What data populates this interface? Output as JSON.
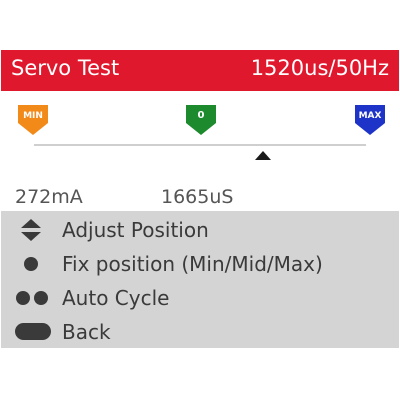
{
  "header": {
    "title": "Servo Test",
    "status": "1520us/50Hz",
    "background": "#e0182d"
  },
  "markers": {
    "min": {
      "label": "MIN",
      "color": "#f28a1a",
      "icon": "min-flag-icon"
    },
    "mid": {
      "label": "0",
      "color": "#1d8a2e",
      "icon": "zero-flag-icon"
    },
    "max": {
      "label": "MAX",
      "color": "#1e33c8",
      "icon": "max-flag-icon"
    }
  },
  "position": {
    "fraction": 0.69,
    "icon": "triangle-pointer-icon"
  },
  "readouts": {
    "current": "272mA",
    "pulse": "1665uS"
  },
  "help": [
    {
      "icon": "up-down-arrows-icon",
      "label": "Adjust Position"
    },
    {
      "icon": "single-dot-icon",
      "label": "Fix position (Min/Mid/Max)"
    },
    {
      "icon": "double-dot-icon",
      "label": "Auto Cycle"
    },
    {
      "icon": "pill-button-icon",
      "label": "Back"
    }
  ]
}
